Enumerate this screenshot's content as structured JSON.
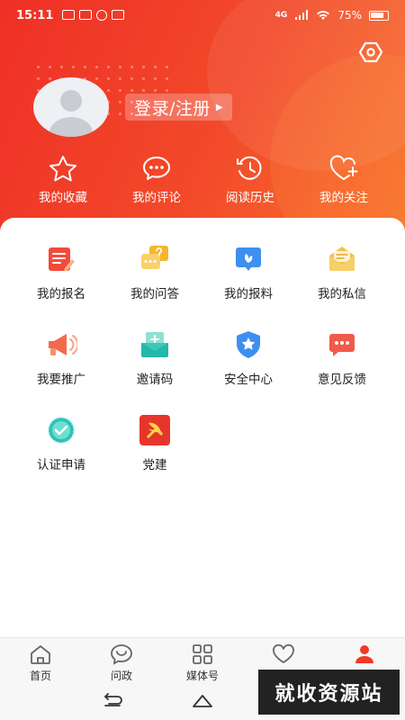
{
  "status": {
    "time": "15:11",
    "network": "4G",
    "battery": "75%"
  },
  "profile": {
    "login_label": "登录/注册"
  },
  "quick_links": [
    {
      "label": "我的收藏",
      "icon": "star-icon"
    },
    {
      "label": "我的评论",
      "icon": "comment-icon"
    },
    {
      "label": "阅读历史",
      "icon": "history-icon"
    },
    {
      "label": "我的关注",
      "icon": "heart-plus-icon"
    }
  ],
  "menu": [
    {
      "label": "我的报名",
      "icon": "signup-icon"
    },
    {
      "label": "我的问答",
      "icon": "qa-icon"
    },
    {
      "label": "我的报料",
      "icon": "report-icon"
    },
    {
      "label": "我的私信",
      "icon": "mail-icon"
    },
    {
      "label": "我要推广",
      "icon": "megaphone-icon"
    },
    {
      "label": "邀请码",
      "icon": "invite-icon"
    },
    {
      "label": "安全中心",
      "icon": "shield-icon"
    },
    {
      "label": "意见反馈",
      "icon": "feedback-icon"
    },
    {
      "label": "认证申请",
      "icon": "verify-icon"
    },
    {
      "label": "党建",
      "icon": "party-icon"
    }
  ],
  "tabs": [
    {
      "label": "首页",
      "icon": "home-icon"
    },
    {
      "label": "问政",
      "icon": "chat-icon"
    },
    {
      "label": "媒体号",
      "icon": "grid-icon"
    },
    {
      "label": "",
      "icon": "heart-icon"
    },
    {
      "label": "",
      "icon": "user-icon"
    }
  ],
  "watermark": "就收资源站",
  "colors": {
    "accent": "#f03a27",
    "header_end": "#f9742f"
  }
}
